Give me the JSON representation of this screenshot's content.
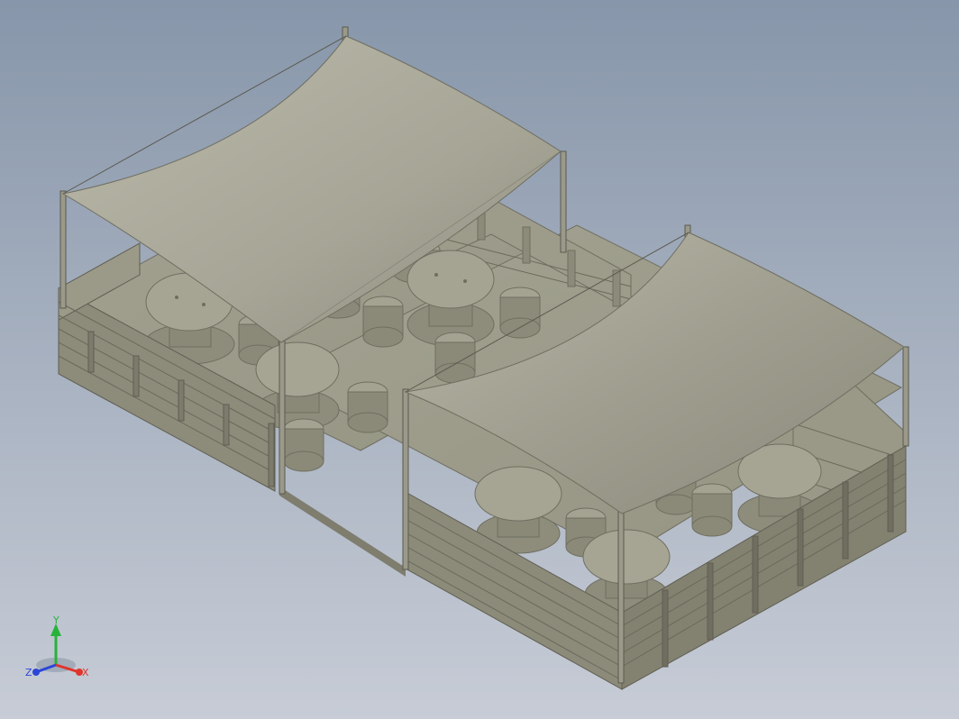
{
  "viewport": {
    "background_top": "#8796aa",
    "background_bottom": "#c7ccd6"
  },
  "model": {
    "description_color": "#9d9c88",
    "shade_light": "#a3a291",
    "shade_mid": "#8e8d7c",
    "shade_dark": "#6f6e60",
    "canopy_light": "#b3b2a4",
    "canopy_dark": "#8a897b"
  },
  "triad": {
    "x_label": "X",
    "y_label": "Y",
    "z_label": "Z",
    "x_color": "#e0352b",
    "y_color": "#27b33a",
    "z_color": "#2c45d8"
  }
}
